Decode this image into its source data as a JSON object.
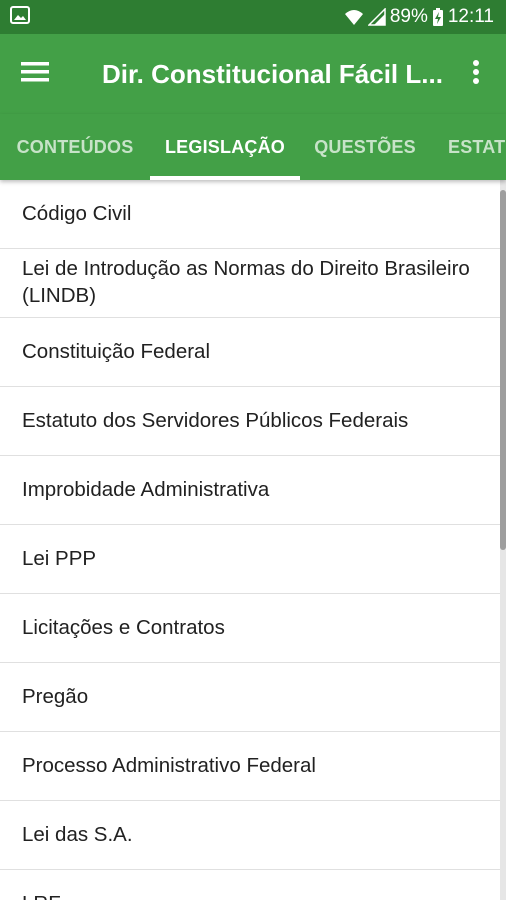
{
  "status_bar": {
    "battery": "89%",
    "time": "12:11",
    "icons": [
      "gallery-notification-icon",
      "wifi-icon",
      "signal-icon",
      "battery-charging-icon"
    ]
  },
  "app_bar": {
    "title": "Dir. Constitucional Fácil L...",
    "menu_icon": "hamburger-menu-icon",
    "overflow_icon": "more-vert-icon"
  },
  "tabs": [
    {
      "label": "CONTEÚDOS",
      "active": false
    },
    {
      "label": "LEGISLAÇÃO",
      "active": true
    },
    {
      "label": "QUESTÕES",
      "active": false
    },
    {
      "label": "ESTATUTOS",
      "active": false
    }
  ],
  "list": {
    "items": [
      "Código Civil",
      "Lei de Introdução as Normas do Direito Brasileiro (LINDB)",
      "Constituição Federal",
      "Estatuto dos Servidores Públicos Federais",
      "Improbidade Administrativa",
      "Lei PPP",
      "Licitações e Contratos",
      "Pregão",
      "Processo Administrativo Federal",
      "Lei das S.A.",
      "LRF"
    ]
  },
  "colors": {
    "status_bar": "#2e7d32",
    "app_bar": "#43a047",
    "text_primary": "#212121",
    "divider": "#e0e0e0"
  }
}
